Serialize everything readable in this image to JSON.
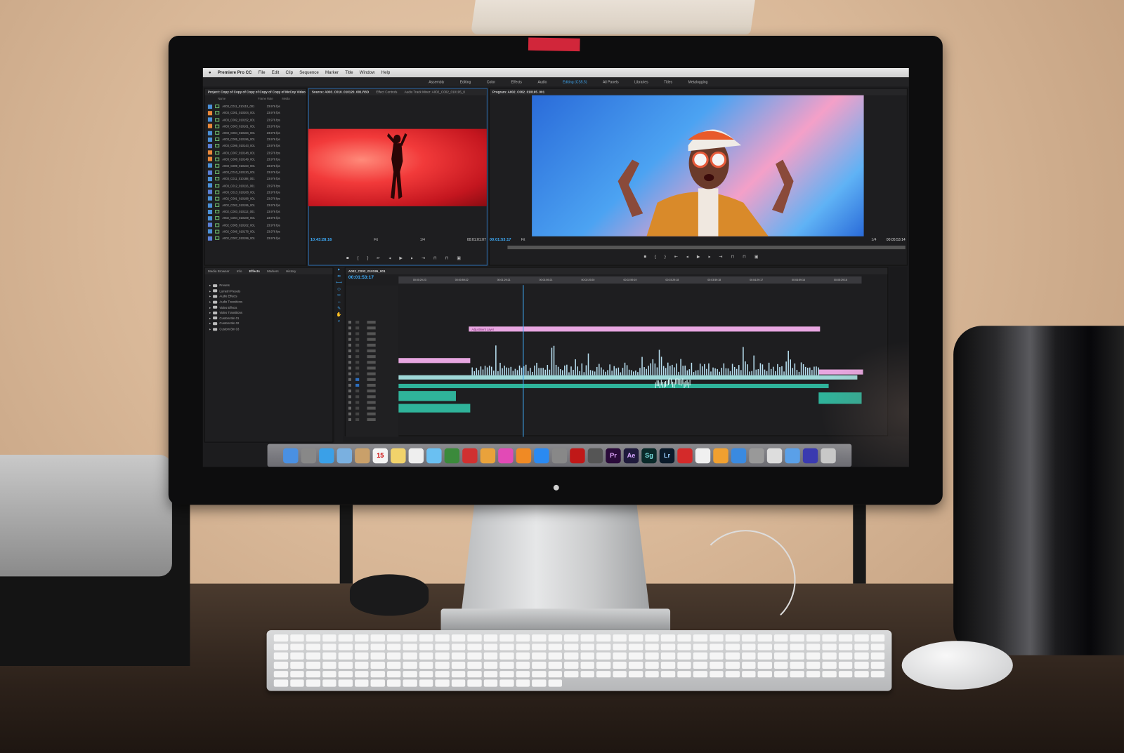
{
  "menubar": {
    "apple_icon": "apple-icon",
    "app": "Premiere Pro CC",
    "items": [
      "File",
      "Edit",
      "Clip",
      "Sequence",
      "Marker",
      "Title",
      "Window",
      "Help"
    ]
  },
  "workspaces": {
    "items": [
      "Assembly",
      "Editing",
      "Color",
      "Effects",
      "Audio",
      "Editing (CS5.5)",
      "All Panels",
      "Libraries",
      "Titles",
      "Metalogging"
    ],
    "active": "Editing (CS5.5)"
  },
  "project": {
    "title": "Project: Copy of Copy of Copy of Copy of Copy of McCoy Video",
    "columns": [
      "Name",
      "Frame Rate",
      "Media"
    ],
    "files": [
      {
        "name": "A003_C011_010110_001",
        "fps": "23.976 fps",
        "color": "#4a8fd6"
      },
      {
        "name": "A003_C001_010204_001",
        "fps": "23.976 fps",
        "color": "#e8883a"
      },
      {
        "name": "A003_C002_010152_001",
        "fps": "23.976 fps",
        "color": "#4a8fd6"
      },
      {
        "name": "A003_C003_010161_001",
        "fps": "23.976 fps",
        "color": "#e8883a"
      },
      {
        "name": "A003_C004_010184_001",
        "fps": "23.976 fps",
        "color": "#4a8fd6"
      },
      {
        "name": "A003_C005_010196_001",
        "fps": "23.976 fps",
        "color": "#4a8fd6"
      },
      {
        "name": "A003_C006_010143_001",
        "fps": "23.976 fps",
        "color": "#5a7fd6"
      },
      {
        "name": "A003_C007_010148_001",
        "fps": "23.976 fps",
        "color": "#e8883a"
      },
      {
        "name": "A003_C008_010149_001",
        "fps": "23.976 fps",
        "color": "#e8883a"
      },
      {
        "name": "A003_C009_010163_001",
        "fps": "23.976 fps",
        "color": "#4a8fd6"
      },
      {
        "name": "A003_C010_010120_001",
        "fps": "23.976 fps",
        "color": "#5a7fd6"
      },
      {
        "name": "A003_C011_010188_001",
        "fps": "23.976 fps",
        "color": "#4a8fd6"
      },
      {
        "name": "A003_C012_010116_001",
        "fps": "23.976 fps",
        "color": "#4a8fd6"
      },
      {
        "name": "A003_C013_010108_001",
        "fps": "23.976 fps",
        "color": "#5a7fd6"
      },
      {
        "name": "A002_C001_010188_001",
        "fps": "23.976 fps",
        "color": "#4a8fd6"
      },
      {
        "name": "A002_C002_010195_001",
        "fps": "23.976 fps",
        "color": "#4a8fd6"
      },
      {
        "name": "A002_C003_010112_001",
        "fps": "23.976 fps",
        "color": "#4a8fd6"
      },
      {
        "name": "A002_C004_010109_001",
        "fps": "23.976 fps",
        "color": "#4a8fd6"
      },
      {
        "name": "A002_C005_010102_001",
        "fps": "23.976 fps",
        "color": "#5a7fd6"
      },
      {
        "name": "A002_C006_010178_001",
        "fps": "23.976 fps",
        "color": "#4a8fd6"
      },
      {
        "name": "A002_C007_010199_001",
        "fps": "23.976 fps",
        "color": "#5a7fd6"
      }
    ]
  },
  "source": {
    "tabs": [
      "Source: A003_C010_010120_001.R3D",
      "Effect Controls",
      "Audio Track Mixer: A002_C002_010195_0"
    ],
    "timecode": "10:43:28:16",
    "fit": "Fit",
    "resolution": "1/4",
    "duration": "00:01:01:07"
  },
  "program": {
    "tab": "Program: A002_C002_010195_001",
    "timecode": "00:01:53:17",
    "fit": "Fit",
    "resolution": "1/4",
    "duration": "00:05:53:14"
  },
  "effects": {
    "tabs": [
      "Media Browser",
      "Info",
      "Effects",
      "Markers",
      "History"
    ],
    "active": "Effects",
    "tree": [
      "Presets",
      "Lumetri Presets",
      "Audio Effects",
      "Audio Transitions",
      "Video Effects",
      "Video Transitions",
      "Custom Bin 01",
      "Custom Bin 02",
      "Custom Bin 03"
    ]
  },
  "timeline": {
    "sequence": "A002_C002_010195_001",
    "timecode": "00:01:53:17",
    "ruler": [
      "00:00:29:23",
      "00:00:59:22",
      "00:01:29:21",
      "00:01:59:21",
      "00:02:29:20",
      "00:02:59:19",
      "00:03:29:18",
      "00:03:59:18",
      "00:04:29:17",
      "00:04:59:16",
      "00:05:29:16"
    ],
    "adjustment_label": "Adjustment Layer",
    "colors": {
      "adjustment": "#e7a6e0",
      "video": "#9fd8d8",
      "audio": "#2fb39a",
      "playhead": "#3fa9f5"
    }
  },
  "dock": {
    "apps": [
      {
        "icon": "finder-icon",
        "label": "",
        "color": "#4a90e2"
      },
      {
        "icon": "launchpad-icon",
        "label": "",
        "color": "#888"
      },
      {
        "icon": "safari-icon",
        "label": "",
        "color": "#3aa0e8"
      },
      {
        "icon": "mail-icon",
        "label": "",
        "color": "#7ab0e0"
      },
      {
        "icon": "contacts-icon",
        "label": "",
        "color": "#c9a06a"
      },
      {
        "icon": "calendar-icon",
        "label": "15",
        "color": "#f4f4f4"
      },
      {
        "icon": "notes-icon",
        "label": "",
        "color": "#f2d36b"
      },
      {
        "icon": "reminders-icon",
        "label": "",
        "color": "#eee"
      },
      {
        "icon": "messages-icon",
        "label": "",
        "color": "#6ac0f2"
      },
      {
        "icon": "facetime-icon",
        "label": "",
        "color": "#3b8a3b"
      },
      {
        "icon": "photobooth-icon",
        "label": "",
        "color": "#d03030"
      },
      {
        "icon": "photos-icon",
        "label": "",
        "color": "#e9a23b"
      },
      {
        "icon": "itunes-icon",
        "label": "",
        "color": "#e24ab6"
      },
      {
        "icon": "ibooks-icon",
        "label": "",
        "color": "#f08a24"
      },
      {
        "icon": "app-store-icon",
        "label": "",
        "color": "#2a8af2"
      },
      {
        "icon": "preferences-icon",
        "label": "",
        "color": "#888"
      },
      {
        "icon": "dvd-icon",
        "label": "",
        "color": "#c01818"
      },
      {
        "icon": "utility-icon",
        "label": "",
        "color": "#555"
      },
      {
        "icon": "premiere-icon",
        "label": "Pr",
        "color": "#2a0a3a",
        "text": "#e3a6ff"
      },
      {
        "icon": "after-effects-icon",
        "label": "Ae",
        "color": "#1f1a3c",
        "text": "#d6a6ff"
      },
      {
        "icon": "speedgrade-icon",
        "label": "Sg",
        "color": "#0a2a2a",
        "text": "#7ae0e0"
      },
      {
        "icon": "lightroom-icon",
        "label": "Lr",
        "color": "#0a1a2a",
        "text": "#9ad0ff"
      },
      {
        "icon": "creative-cloud-icon",
        "label": "",
        "color": "#d42a2a"
      },
      {
        "icon": "music-icon",
        "label": "",
        "color": "#f0f0f0"
      },
      {
        "icon": "ibooks2-icon",
        "label": "",
        "color": "#f0a030"
      },
      {
        "icon": "appstore2-icon",
        "label": "",
        "color": "#3a8ae0"
      },
      {
        "icon": "system-prefs-icon",
        "label": "",
        "color": "#999"
      },
      {
        "icon": "preview-icon",
        "label": "",
        "color": "#ddd"
      },
      {
        "icon": "folder-icon",
        "label": "",
        "color": "#5aa0e8"
      },
      {
        "icon": "document-icon",
        "label": "",
        "color": "#3a3ab0"
      },
      {
        "icon": "trash-icon",
        "label": "",
        "color": "#c8c8c8"
      }
    ]
  }
}
